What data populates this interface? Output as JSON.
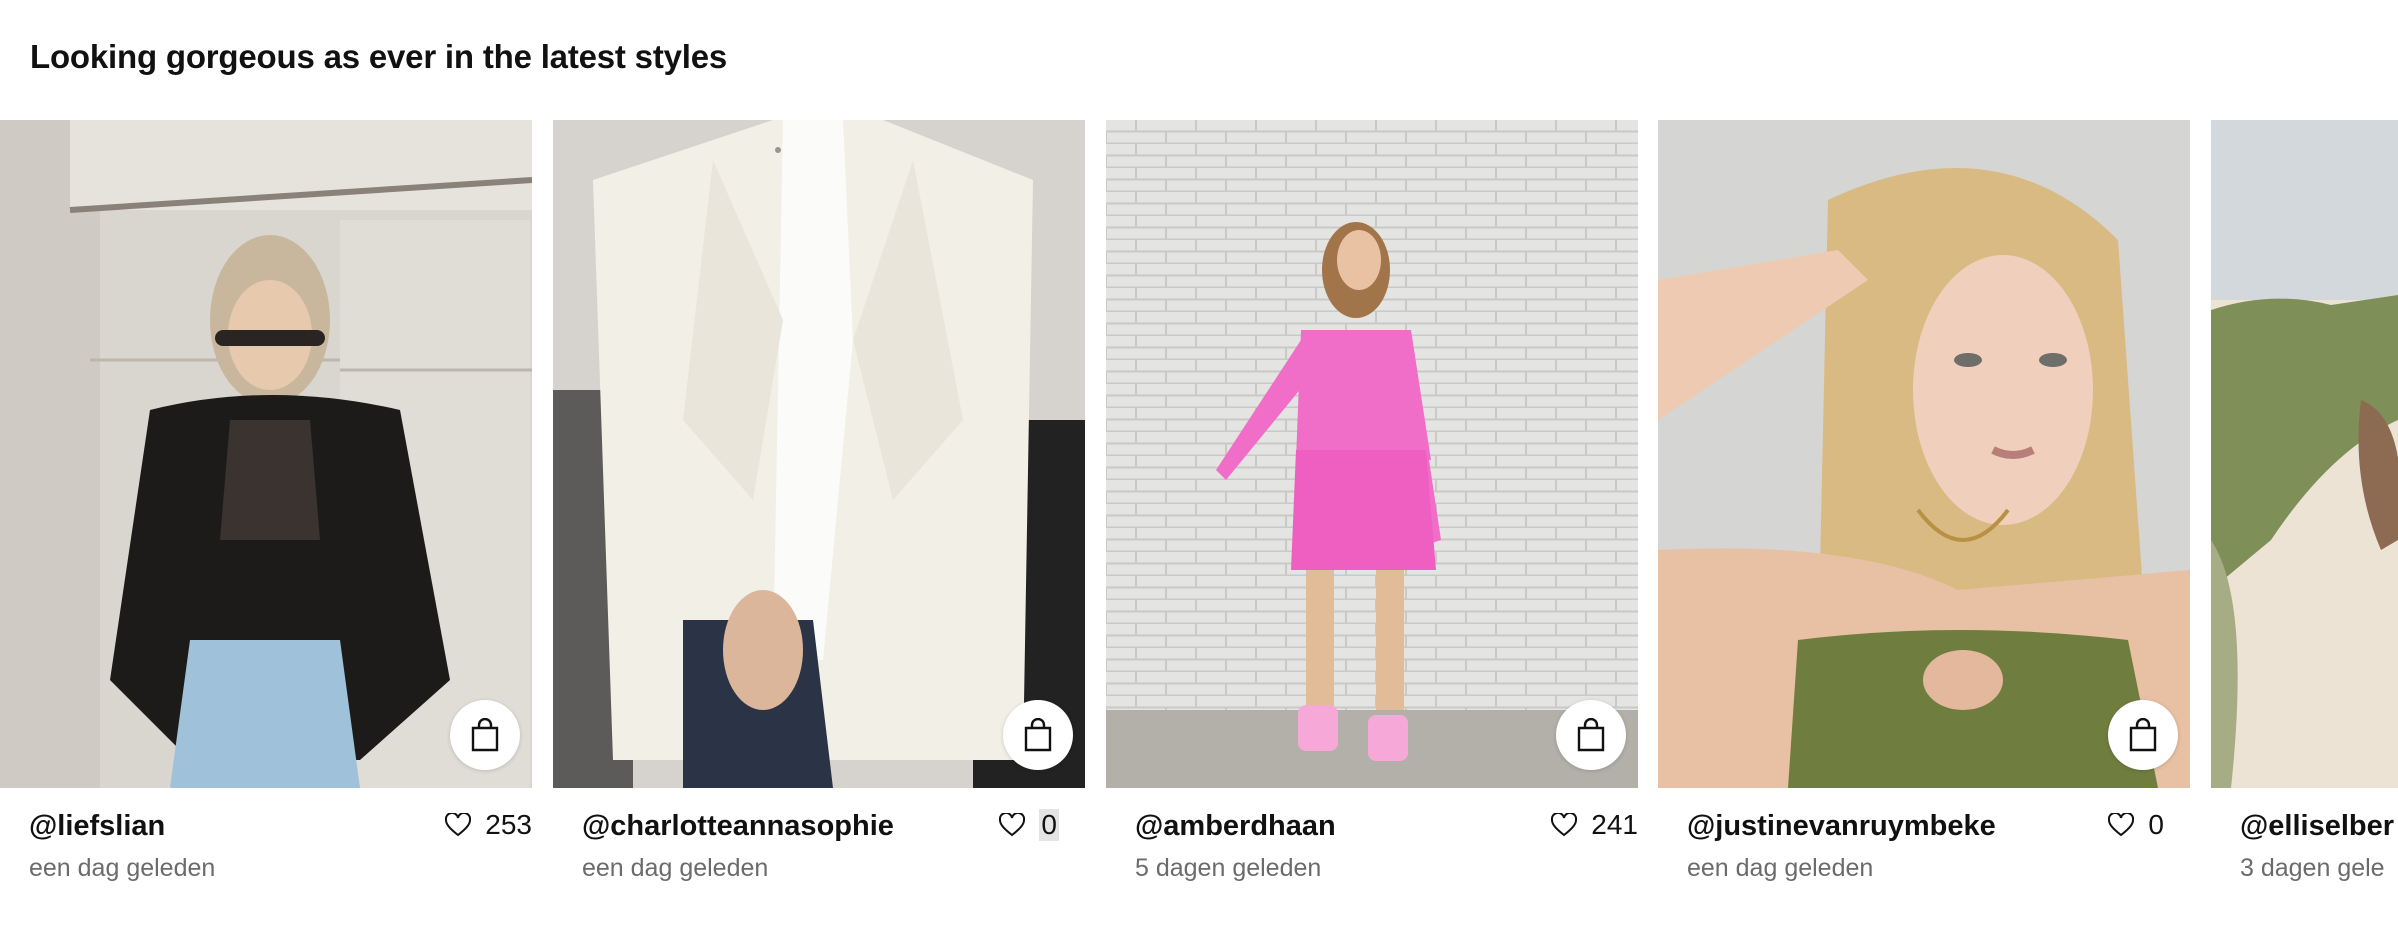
{
  "section": {
    "title": "Looking gorgeous as ever in the latest styles"
  },
  "colors": {
    "text": "#111111",
    "secondary_text": "#6b6b6b",
    "background": "#ffffff"
  },
  "icons": {
    "shop": "shopping-bag-icon",
    "like": "heart-icon"
  },
  "posts": [
    {
      "handle": "@liefslian",
      "likes": "253",
      "time": "een dag geleden"
    },
    {
      "handle": "@charlotteannasophie",
      "likes": "0",
      "time": "een dag geleden"
    },
    {
      "handle": "@amberdhaan",
      "likes": "241",
      "time": "5 dagen geleden"
    },
    {
      "handle": "@justinevanruymbeke",
      "likes": "0",
      "time": "een dag geleden"
    },
    {
      "handle": "@elliselber",
      "time": "3 dagen gele"
    }
  ]
}
